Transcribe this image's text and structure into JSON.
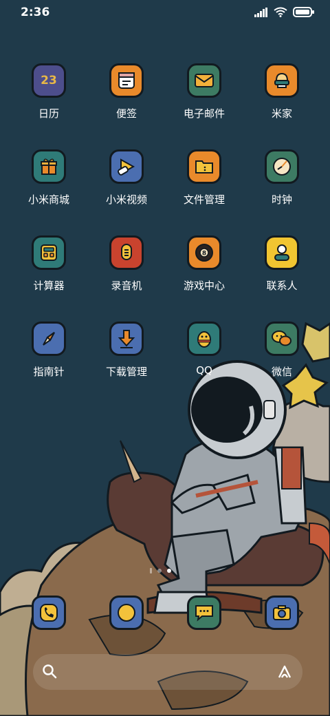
{
  "status_bar": {
    "time": "2:36"
  },
  "apps": [
    {
      "label": "日历",
      "icon": "calendar-icon",
      "color": "#4d4e8c",
      "date": "23"
    },
    {
      "label": "便签",
      "icon": "notes-icon",
      "color": "#e98a2b"
    },
    {
      "label": "电子邮件",
      "icon": "mail-icon",
      "color": "#3d7b63"
    },
    {
      "label": "米家",
      "icon": "mijia-icon",
      "color": "#e98a2b"
    },
    {
      "label": "小米商城",
      "icon": "gift-icon",
      "color": "#2f7b78"
    },
    {
      "label": "小米视频",
      "icon": "video-icon",
      "color": "#4b6eb0"
    },
    {
      "label": "文件管理",
      "icon": "folder-icon",
      "color": "#e98a2b"
    },
    {
      "label": "时钟",
      "icon": "clock-icon",
      "color": "#3d7b63"
    },
    {
      "label": "计算器",
      "icon": "calculator-icon",
      "color": "#2f7b78"
    },
    {
      "label": "录音机",
      "icon": "recorder-icon",
      "color": "#c9432e"
    },
    {
      "label": "游戏中心",
      "icon": "game-ball-icon",
      "color": "#e98a2b"
    },
    {
      "label": "联系人",
      "icon": "contact-icon",
      "color": "#f1c531"
    },
    {
      "label": "指南针",
      "icon": "compass-icon",
      "color": "#4b6eb0"
    },
    {
      "label": "下载管理",
      "icon": "download-icon",
      "color": "#4b6eb0"
    },
    {
      "label": "QQ",
      "icon": "qq-penguin-icon",
      "color": "#2f7b78"
    },
    {
      "label": "微信",
      "icon": "wechat-icon",
      "color": "#3d7b63"
    }
  ],
  "dock": [
    {
      "icon": "phone-icon",
      "color": "#4b6eb0"
    },
    {
      "icon": "browser-icon",
      "color": "#4b6eb0"
    },
    {
      "icon": "messages-icon",
      "color": "#3d7b63"
    },
    {
      "icon": "camera-icon",
      "color": "#4b6eb0"
    }
  ],
  "page_indicator": {
    "count": 3,
    "active": 2
  },
  "search_bar": {
    "left_icon": "search-icon",
    "right_icon": "assistant-icon"
  }
}
